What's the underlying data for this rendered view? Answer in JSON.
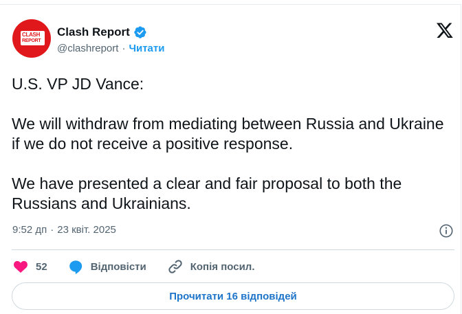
{
  "author": {
    "name": "Clash Report",
    "handle": "@clashreport",
    "follow_label": "Читати",
    "avatar_text_line1": "CLASH",
    "avatar_text_line2": "REPORT",
    "brand_color": "#e0171b",
    "verified_color": "#1d9bf0"
  },
  "tweet": {
    "paragraphs": [
      "U.S. VP JD Vance:",
      "We will withdraw from mediating between Russia and Ukraine if we do not receive a positive response.",
      "We have presented a clear and fair proposal to both the Russians and Ukrainians."
    ],
    "time": "9:52 дп",
    "date": "23 квіт. 2025"
  },
  "actions": {
    "like_count": "52",
    "reply_label": "Відповісти",
    "copy_link_label": "Копія посил.",
    "like_color": "#f91880",
    "reply_color": "#1d9bf0"
  },
  "read_replies_label": "Прочитати 16 відповідей",
  "icons": [
    "verified-badge-icon",
    "x-logo-icon",
    "info-icon",
    "heart-icon",
    "reply-bubble-icon",
    "link-icon"
  ]
}
